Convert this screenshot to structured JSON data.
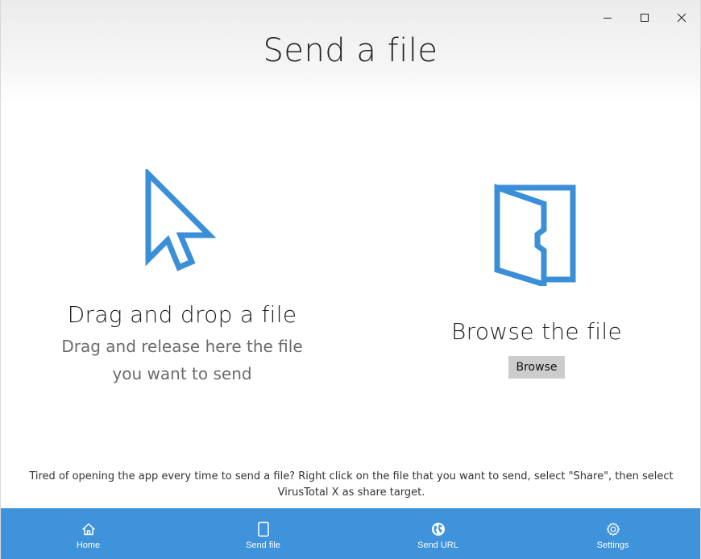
{
  "window": {
    "controls": {
      "minimize": "minimize-icon",
      "maximize": "maximize-icon",
      "close": "close-icon"
    }
  },
  "page": {
    "title": "Send a file"
  },
  "drag_panel": {
    "icon": "cursor-arrow-icon",
    "heading": "Drag and drop a file",
    "subtext": "Drag and release here the file you want to send"
  },
  "browse_panel": {
    "icon": "open-folder-icon",
    "heading": "Browse the file",
    "button_label": "Browse"
  },
  "tip": {
    "text": "Tired of opening the app every time to send a file? Right click on the file that you want to send, select \"Share\", then select VirusTotal X as share target."
  },
  "nav": {
    "items": [
      {
        "label": "Home",
        "icon": "home-icon"
      },
      {
        "label": "Send file",
        "icon": "file-icon"
      },
      {
        "label": "Send URL",
        "icon": "globe-icon"
      },
      {
        "label": "Settings",
        "icon": "gear-icon"
      }
    ]
  },
  "colors": {
    "accent": "#3f93da",
    "icon_blue": "#3a8fd8",
    "button_gray": "#cccccc"
  }
}
